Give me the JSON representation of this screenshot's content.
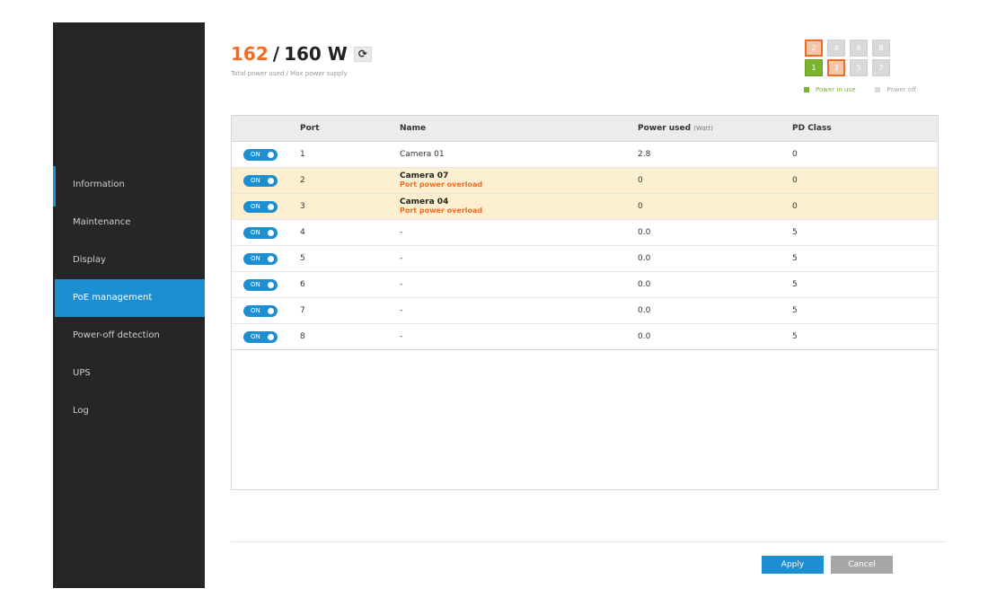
{
  "power": {
    "used": "162",
    "separator": "/",
    "max": "160 W",
    "caption": "Total power used / Max power supply",
    "refresh_icon": "⟳"
  },
  "ports_grid": {
    "top_row": [
      "2",
      "4",
      "6",
      "8"
    ],
    "bottom_row": [
      "1",
      "3",
      "5",
      "7"
    ]
  },
  "legend": {
    "in_use": "Power in use",
    "off": "Power off",
    "colors": {
      "in_use": "#7ab32e",
      "off": "#d9d9d9",
      "overload": "#f26b21"
    }
  },
  "sidebar": {
    "items": [
      {
        "label": "Information"
      },
      {
        "label": "Maintenance"
      },
      {
        "label": "Display"
      },
      {
        "label": "PoE management"
      },
      {
        "label": "Power-off detection"
      },
      {
        "label": "UPS"
      },
      {
        "label": "Log"
      }
    ],
    "active": "PoE management"
  },
  "table": {
    "headers": {
      "port": "Port",
      "name": "Name",
      "power": "Power used",
      "power_unit": "(Watt)",
      "pd_class": "PD Class"
    },
    "toggle_label": "ON",
    "rows": [
      {
        "port": "1",
        "name": "Camera 01",
        "warning": "",
        "power": "2.8",
        "pd_class": "0"
      },
      {
        "port": "2",
        "name": "Camera 07",
        "warning": "Port power overload",
        "power": "0",
        "pd_class": "0"
      },
      {
        "port": "3",
        "name": "Camera 04",
        "warning": "Port power overload",
        "power": "0",
        "pd_class": "0"
      },
      {
        "port": "4",
        "name": "-",
        "warning": "",
        "power": "0.0",
        "pd_class": "5"
      },
      {
        "port": "5",
        "name": "-",
        "warning": "",
        "power": "0.0",
        "pd_class": "5"
      },
      {
        "port": "6",
        "name": "-",
        "warning": "",
        "power": "0.0",
        "pd_class": "5"
      },
      {
        "port": "7",
        "name": "-",
        "warning": "",
        "power": "0.0",
        "pd_class": "5"
      },
      {
        "port": "8",
        "name": "-",
        "warning": "",
        "power": "0.0",
        "pd_class": "5"
      }
    ]
  },
  "buttons": {
    "apply": "Apply",
    "cancel": "Cancel"
  },
  "colors": {
    "accent": "#1b8fd2",
    "warning": "#f26b21",
    "overload_row": "#fcefcf",
    "sidebar": "#262626"
  }
}
